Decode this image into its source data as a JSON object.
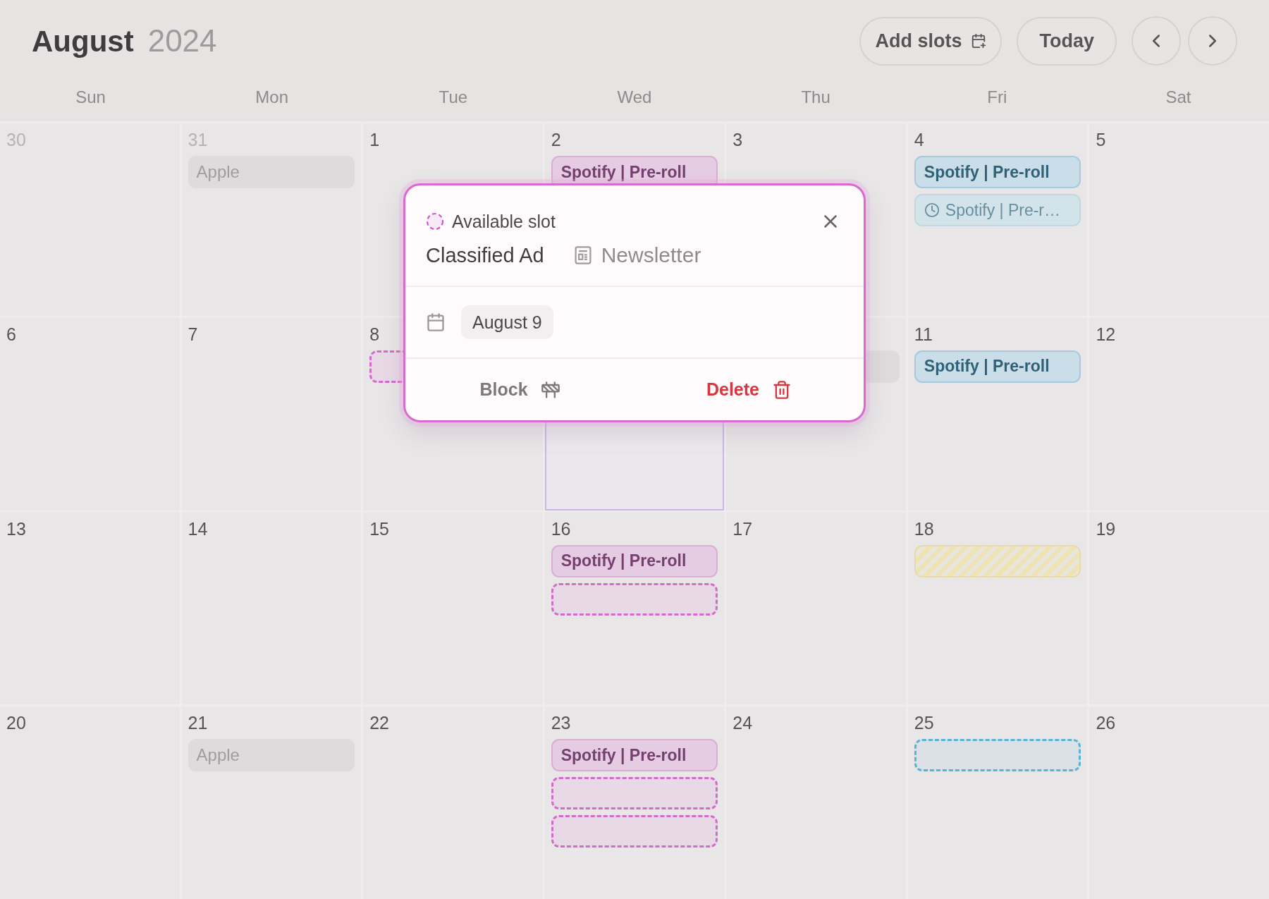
{
  "header": {
    "month": "August",
    "year": "2024",
    "buttons": [
      {
        "kind": "add",
        "label": "Add slots"
      },
      {
        "kind": "today",
        "label": "Today"
      }
    ]
  },
  "weekdays": [
    "Sun",
    "Mon",
    "Tue",
    "Wed",
    "Thu",
    "Fri",
    "Sat"
  ],
  "weeks": [
    {
      "days": [
        {
          "day": "30",
          "outside": true,
          "selected": false
        },
        {
          "day": "31",
          "outside": true,
          "selected": false,
          "events": [
            {
              "kind": "muted",
              "label": "Apple"
            }
          ]
        },
        {
          "day": "1",
          "outside": false,
          "selected": false
        },
        {
          "day": "2",
          "outside": false,
          "selected": false,
          "events": [
            {
              "kind": "booked",
              "label": "Spotify | Pre-roll",
              "color": "#e6cce2"
            }
          ]
        },
        {
          "day": "3",
          "outside": false,
          "selected": false
        },
        {
          "day": "4",
          "outside": false,
          "selected": false,
          "events": [
            {
              "kind": "booked",
              "label": "Spotify | Pre-roll",
              "color": "#c9dee8"
            },
            {
              "kind": "pending",
              "label": "Spotify | Pre-r…",
              "color": "#d3e3ea"
            }
          ]
        },
        {
          "day": "5",
          "outside": false,
          "selected": false
        }
      ]
    },
    {
      "days": [
        {
          "day": "6",
          "outside": false,
          "selected": false
        },
        {
          "day": "7",
          "outside": false,
          "selected": false
        },
        {
          "day": "8",
          "outside": false,
          "selected": false,
          "events": [
            {
              "kind": "slot",
              "color": "#d56bc8"
            }
          ]
        },
        {
          "selected": true
        },
        {
          "selected": false,
          "events": [
            {
              "kind": "muted"
            }
          ]
        },
        {
          "day": "11",
          "outside": false,
          "selected": false,
          "events": [
            {
              "kind": "booked",
              "label": "Spotify | Pre-roll",
              "color": "#c9dee8"
            }
          ]
        },
        {
          "day": "12",
          "outside": false,
          "selected": false
        }
      ]
    },
    {
      "days": [
        {
          "day": "13",
          "outside": false,
          "selected": false
        },
        {
          "day": "14",
          "outside": false,
          "selected": false
        },
        {
          "day": "15",
          "outside": false,
          "selected": false
        },
        {
          "day": "16",
          "outside": false,
          "selected": false,
          "events": [
            {
              "kind": "booked",
              "label": "Spotify | Pre-roll",
              "color": "#e6cce2"
            },
            {
              "kind": "slot",
              "color": "#d56bc8"
            }
          ]
        },
        {
          "day": "17",
          "outside": false,
          "selected": false
        },
        {
          "day": "18",
          "outside": false,
          "selected": false,
          "events": [
            {
              "kind": "blocked",
              "color": "#eee3b3"
            }
          ]
        },
        {
          "day": "19",
          "outside": false,
          "selected": false
        }
      ]
    },
    {
      "days": [
        {
          "day": "20",
          "outside": false,
          "selected": false
        },
        {
          "day": "21",
          "outside": false,
          "selected": false,
          "events": [
            {
              "kind": "muted",
              "label": "Apple"
            }
          ]
        },
        {
          "day": "22",
          "outside": false,
          "selected": false
        },
        {
          "day": "23",
          "outside": false,
          "selected": false,
          "events": [
            {
              "kind": "booked",
              "label": "Spotify | Pre-roll",
              "color": "#e6cce2"
            },
            {
              "kind": "slot",
              "color": "#d56bc8"
            },
            {
              "kind": "slot",
              "color": "#d56bc8"
            }
          ]
        },
        {
          "day": "24",
          "outside": false,
          "selected": false
        },
        {
          "day": "25",
          "outside": false,
          "selected": false,
          "events": [
            {
              "kind": "slot",
              "color": "#58b4d6"
            }
          ]
        },
        {
          "day": "26",
          "outside": false,
          "selected": false
        }
      ]
    }
  ],
  "popup": {
    "status": "Available slot",
    "title": "Classified Ad",
    "channel": "Newsletter",
    "date": "August 9",
    "actions": [
      {
        "kind": "block",
        "label": "Block"
      },
      {
        "kind": "delete",
        "label": "Delete"
      }
    ]
  }
}
